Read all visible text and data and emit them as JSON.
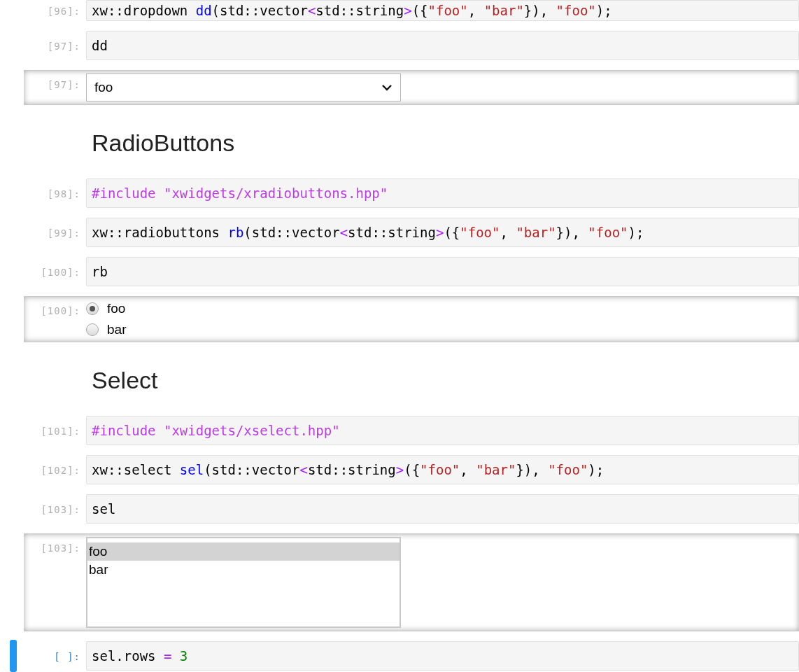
{
  "cells": [
    {
      "kind": "input",
      "prompt": "[96]:",
      "code": [
        {
          "text": "xw::dropdown ",
          "kind": "plain"
        },
        {
          "text": "dd",
          "kind": "name"
        },
        {
          "text": "(std::vector",
          "kind": "plain"
        },
        {
          "text": "<",
          "kind": "operator"
        },
        {
          "text": "std::string",
          "kind": "plain"
        },
        {
          "text": ">",
          "kind": "operator"
        },
        {
          "text": "({",
          "kind": "plain"
        },
        {
          "text": "\"foo\"",
          "kind": "string"
        },
        {
          "text": ", ",
          "kind": "plain"
        },
        {
          "text": "\"bar\"",
          "kind": "string"
        },
        {
          "text": "}), ",
          "kind": "plain"
        },
        {
          "text": "\"foo\"",
          "kind": "string"
        },
        {
          "text": ");",
          "kind": "plain"
        }
      ]
    },
    {
      "kind": "input",
      "prompt": "[97]:",
      "code": [
        {
          "text": "dd",
          "kind": "plain"
        }
      ]
    },
    {
      "kind": "output",
      "prompt": "[97]:",
      "widget": {
        "kind": "dropdown",
        "value": "foo"
      }
    },
    {
      "kind": "heading",
      "text": "RadioButtons"
    },
    {
      "kind": "input",
      "prompt": "[98]:",
      "code": [
        {
          "text": "#include \"xwidgets/xradiobuttons.hpp\"",
          "kind": "directive"
        }
      ]
    },
    {
      "kind": "input",
      "prompt": "[99]:",
      "code": [
        {
          "text": "xw::radiobuttons ",
          "kind": "plain"
        },
        {
          "text": "rb",
          "kind": "name"
        },
        {
          "text": "(std::vector",
          "kind": "plain"
        },
        {
          "text": "<",
          "kind": "operator"
        },
        {
          "text": "std::string",
          "kind": "plain"
        },
        {
          "text": ">",
          "kind": "operator"
        },
        {
          "text": "({",
          "kind": "plain"
        },
        {
          "text": "\"foo\"",
          "kind": "string"
        },
        {
          "text": ", ",
          "kind": "plain"
        },
        {
          "text": "\"bar\"",
          "kind": "string"
        },
        {
          "text": "}), ",
          "kind": "plain"
        },
        {
          "text": "\"foo\"",
          "kind": "string"
        },
        {
          "text": ");",
          "kind": "plain"
        }
      ]
    },
    {
      "kind": "input",
      "prompt": "[100]:",
      "code": [
        {
          "text": "rb",
          "kind": "plain"
        }
      ]
    },
    {
      "kind": "output",
      "prompt": "[100]:",
      "widget": {
        "kind": "radio",
        "options": [
          {
            "label": "foo",
            "selected": true
          },
          {
            "label": "bar",
            "selected": false
          }
        ]
      }
    },
    {
      "kind": "heading",
      "text": "Select"
    },
    {
      "kind": "input",
      "prompt": "[101]:",
      "code": [
        {
          "text": "#include \"xwidgets/xselect.hpp\"",
          "kind": "directive"
        }
      ]
    },
    {
      "kind": "input",
      "prompt": "[102]:",
      "code": [
        {
          "text": "xw::select ",
          "kind": "plain"
        },
        {
          "text": "sel",
          "kind": "name"
        },
        {
          "text": "(std::vector",
          "kind": "plain"
        },
        {
          "text": "<",
          "kind": "operator"
        },
        {
          "text": "std::string",
          "kind": "plain"
        },
        {
          "text": ">",
          "kind": "operator"
        },
        {
          "text": "({",
          "kind": "plain"
        },
        {
          "text": "\"foo\"",
          "kind": "string"
        },
        {
          "text": ", ",
          "kind": "plain"
        },
        {
          "text": "\"bar\"",
          "kind": "string"
        },
        {
          "text": "}), ",
          "kind": "plain"
        },
        {
          "text": "\"foo\"",
          "kind": "string"
        },
        {
          "text": ");",
          "kind": "plain"
        }
      ]
    },
    {
      "kind": "input",
      "prompt": "[103]:",
      "code": [
        {
          "text": "sel",
          "kind": "plain"
        }
      ]
    },
    {
      "kind": "output",
      "prompt": "[103]:",
      "widget": {
        "kind": "select",
        "options": [
          {
            "label": "foo",
            "selected": true
          },
          {
            "label": "bar",
            "selected": false
          }
        ]
      }
    },
    {
      "kind": "input",
      "prompt": "[ ]:",
      "active": true,
      "code": [
        {
          "text": "sel.rows ",
          "kind": "plain"
        },
        {
          "text": "=",
          "kind": "operator"
        },
        {
          "text": " 3",
          "kind": "number"
        }
      ]
    }
  ]
}
